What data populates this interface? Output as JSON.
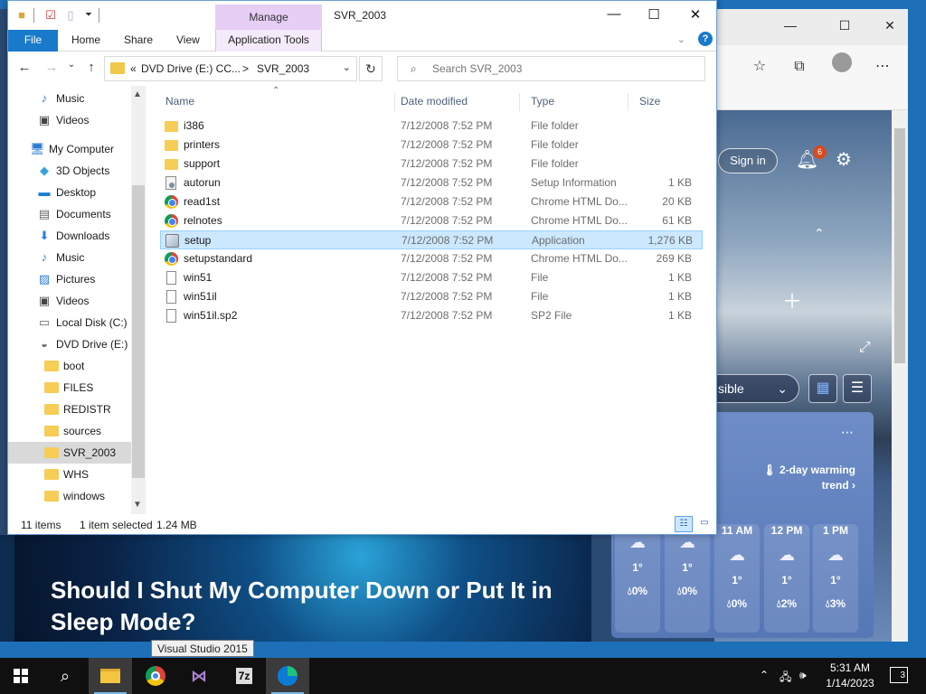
{
  "explorer": {
    "title": "SVR_2003",
    "manage_tab": "Manage",
    "ribbon": {
      "tabs": [
        "File",
        "Home",
        "Share",
        "View",
        "Application Tools"
      ]
    },
    "address": {
      "overflow": "«",
      "parent": "DVD Drive (E:) CC...",
      "separator": ">",
      "current": "SVR_2003"
    },
    "search": {
      "placeholder": "Search SVR_2003"
    },
    "nav": {
      "items": [
        {
          "label": "Music",
          "icon": "music-icon"
        },
        {
          "label": "Videos",
          "icon": "videos-icon"
        },
        {
          "label": "My Computer",
          "icon": "computer-icon"
        },
        {
          "label": "3D Objects",
          "icon": "3d-objects-icon"
        },
        {
          "label": "Desktop",
          "icon": "desktop-icon"
        },
        {
          "label": "Documents",
          "icon": "documents-icon"
        },
        {
          "label": "Downloads",
          "icon": "downloads-icon"
        },
        {
          "label": "Music",
          "icon": "music-icon"
        },
        {
          "label": "Pictures",
          "icon": "pictures-icon"
        },
        {
          "label": "Videos",
          "icon": "videos-icon"
        },
        {
          "label": "Local Disk (C:)",
          "icon": "local-disk-icon"
        },
        {
          "label": "DVD Drive (E:) C",
          "icon": "dvd-drive-icon"
        },
        {
          "label": "boot",
          "icon": "folder-icon"
        },
        {
          "label": "FILES",
          "icon": "folder-icon"
        },
        {
          "label": "REDISTR",
          "icon": "folder-icon"
        },
        {
          "label": "sources",
          "icon": "folder-icon"
        },
        {
          "label": "SVR_2003",
          "icon": "folder-icon"
        },
        {
          "label": "WHS",
          "icon": "folder-icon"
        },
        {
          "label": "windows",
          "icon": "folder-icon"
        }
      ],
      "selected": "SVR_2003"
    },
    "columns": [
      "Name",
      "Date modified",
      "Type",
      "Size"
    ],
    "files": [
      {
        "name": "i386",
        "date": "7/12/2008 7:52 PM",
        "type": "File folder",
        "size": "",
        "icon": "folder-icon"
      },
      {
        "name": "printers",
        "date": "7/12/2008 7:52 PM",
        "type": "File folder",
        "size": "",
        "icon": "folder-icon"
      },
      {
        "name": "support",
        "date": "7/12/2008 7:52 PM",
        "type": "File folder",
        "size": "",
        "icon": "folder-icon"
      },
      {
        "name": "autorun",
        "date": "7/12/2008 7:52 PM",
        "type": "Setup Information",
        "size": "1 KB",
        "icon": "setup-info-icon"
      },
      {
        "name": "read1st",
        "date": "7/12/2008 7:52 PM",
        "type": "Chrome HTML Do...",
        "size": "20 KB",
        "icon": "chrome-icon"
      },
      {
        "name": "relnotes",
        "date": "7/12/2008 7:52 PM",
        "type": "Chrome HTML Do...",
        "size": "61 KB",
        "icon": "chrome-icon"
      },
      {
        "name": "setup",
        "date": "7/12/2008 7:52 PM",
        "type": "Application",
        "size": "1,276 KB",
        "icon": "application-icon"
      },
      {
        "name": "setupstandard",
        "date": "7/12/2008 7:52 PM",
        "type": "Chrome HTML Do...",
        "size": "269 KB",
        "icon": "chrome-icon"
      },
      {
        "name": "win51",
        "date": "7/12/2008 7:52 PM",
        "type": "File",
        "size": "1 KB",
        "icon": "file-icon"
      },
      {
        "name": "win51il",
        "date": "7/12/2008 7:52 PM",
        "type": "File",
        "size": "1 KB",
        "icon": "file-icon"
      },
      {
        "name": "win51il.sp2",
        "date": "7/12/2008 7:52 PM",
        "type": "SP2 File",
        "size": "1 KB",
        "icon": "file-icon"
      }
    ],
    "selected_file": "setup",
    "status": {
      "count": "11 items",
      "selection": "1 item selected",
      "size": "1.24 MB"
    }
  },
  "edge": {
    "signin": "Sign in",
    "notification_count": "6",
    "visible_dropdown": "sible",
    "weather": {
      "trend": "2-day warming trend",
      "hours": [
        {
          "time": "",
          "temp": "1°",
          "precip": "0%"
        },
        {
          "time": "",
          "temp": "1°",
          "precip": "0%"
        },
        {
          "time": "11 AM",
          "temp": "1°",
          "precip": "0%"
        },
        {
          "time": "12 PM",
          "temp": "1°",
          "precip": "2%"
        },
        {
          "time": "1 PM",
          "temp": "1°",
          "precip": "3%"
        }
      ]
    },
    "news_title": "Should I Shut My Computer Down or Put It in Sleep Mode?"
  },
  "tooltip": "Visual Studio 2015",
  "taskbar": {
    "apps": [
      "start",
      "search",
      "file-explorer",
      "chrome",
      "visual-studio",
      "7zip",
      "edge"
    ],
    "time": "5:31 AM",
    "date": "1/14/2023",
    "notification_count": "3"
  },
  "colors": {
    "accent": "#1979ca",
    "manage_tab": "#e6cef5",
    "selection": "#cce8ff",
    "folder": "#f5cd57",
    "taskbar": "#101010"
  }
}
